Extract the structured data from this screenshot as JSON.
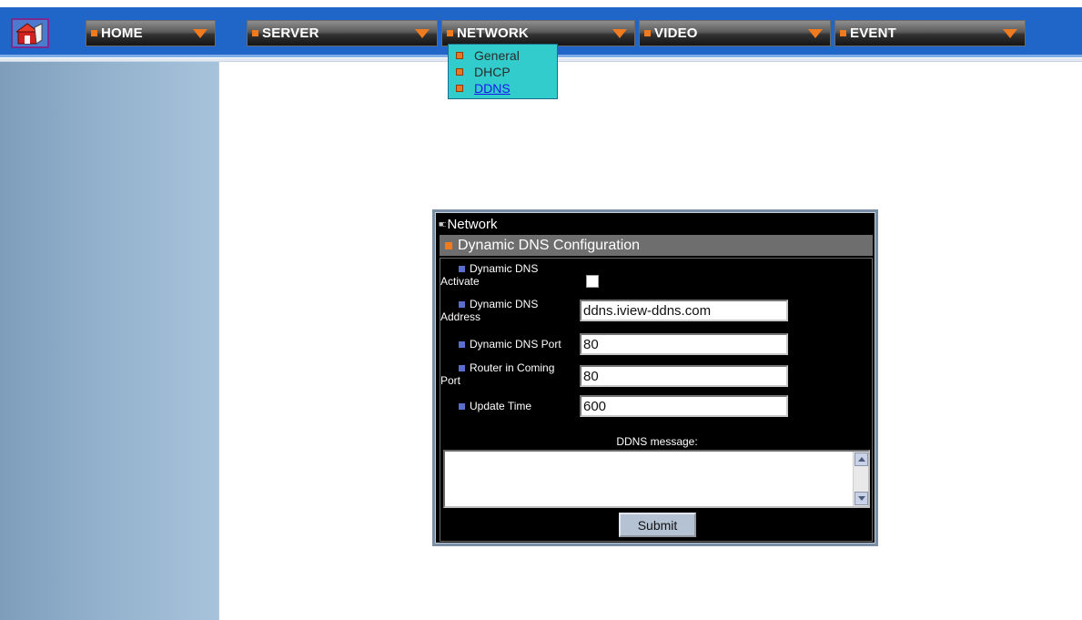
{
  "nav": {
    "home": "HOME",
    "server": "SERVER",
    "network": "NETWORK",
    "video": "VIDEO",
    "event": "EVENT"
  },
  "dropdown": {
    "items": [
      {
        "label": "General"
      },
      {
        "label": "DHCP"
      },
      {
        "label": "DDNS"
      }
    ]
  },
  "panel": {
    "title": "Network",
    "section": "Dynamic DNS Configuration",
    "fields": {
      "activate_label": "Dynamic DNS Activate",
      "activate_checked": false,
      "address_label": "Dynamic DNS Address",
      "address_value": "ddns.iview-ddns.com",
      "port_label": "Dynamic DNS Port",
      "port_value": "80",
      "router_label": "Router in Coming Port",
      "router_value": "80",
      "update_label": "Update Time",
      "update_value": "600"
    },
    "message_label": "DDNS message:",
    "message_value": "",
    "submit_label": "Submit"
  },
  "colors": {
    "nav_blue": "#1f66c8",
    "accent_orange": "#f07a1e",
    "dropdown_bg": "#33cccc",
    "panel_bg": "#000000",
    "section_bar": "#6e6e6e"
  },
  "icons": [
    "home-icon",
    "menu-arrow-icon",
    "scroll-up-icon",
    "scroll-down-icon"
  ]
}
